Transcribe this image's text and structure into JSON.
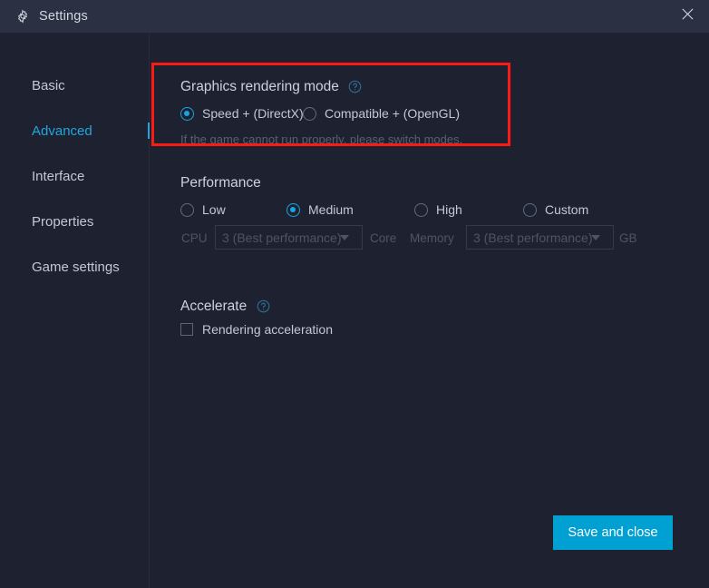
{
  "window": {
    "title": "Settings",
    "gear_icon": "gear-icon",
    "close_icon": "close-icon"
  },
  "sidebar": {
    "items": [
      {
        "label": "Basic",
        "active": false
      },
      {
        "label": "Advanced",
        "active": true
      },
      {
        "label": "Interface",
        "active": false
      },
      {
        "label": "Properties",
        "active": false
      },
      {
        "label": "Game settings",
        "active": false
      }
    ]
  },
  "main": {
    "graphics": {
      "title": "Graphics rendering mode",
      "help_icon": "help-circle-icon",
      "options": [
        {
          "label": "Speed + (DirectX)",
          "selected": true
        },
        {
          "label": "Compatible + (OpenGL)",
          "selected": false
        }
      ],
      "hint": "If the game cannot run properly, please switch modes."
    },
    "performance": {
      "title": "Performance",
      "options": [
        {
          "label": "Low",
          "selected": false
        },
        {
          "label": "Medium",
          "selected": true
        },
        {
          "label": "High",
          "selected": false
        },
        {
          "label": "Custom",
          "selected": false
        }
      ],
      "cpu_label": "CPU",
      "cpu_value": "3 (Best performance)",
      "core_unit": "Core",
      "memory_label": "Memory",
      "memory_value": "3 (Best performance)",
      "memory_unit": "GB"
    },
    "accelerate": {
      "title": "Accelerate",
      "help_icon": "help-circle-icon",
      "checkbox_label": "Rendering acceleration",
      "checked": false
    }
  },
  "footer": {
    "save_label": "Save and close"
  },
  "colors": {
    "accent": "#01a0d2",
    "radio_on": "#18a4e0",
    "highlight": "#fb1b12",
    "titlebar_bg": "#2b3143",
    "body_bg": "#1e2230"
  }
}
